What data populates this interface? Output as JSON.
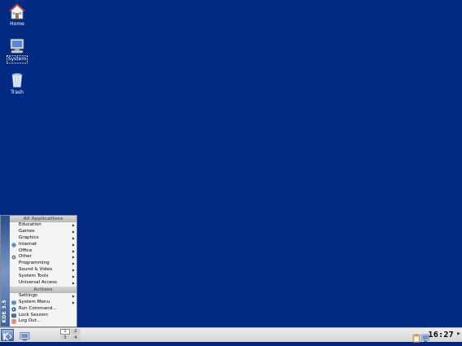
{
  "desktop": {
    "icons": [
      {
        "label": "Home",
        "icon": "home-folder-icon"
      },
      {
        "label": "System",
        "icon": "computer-icon",
        "selected": true
      },
      {
        "label": "Trash",
        "icon": "trash-icon"
      }
    ],
    "background_color": "#032a82"
  },
  "kmenu": {
    "side_label": "KDE 3.5",
    "all_applications_header": "All Applications",
    "applications": [
      {
        "label": "Education",
        "submenu": true
      },
      {
        "label": "Games",
        "submenu": true
      },
      {
        "label": "Graphics",
        "submenu": true
      },
      {
        "label": "Internet",
        "submenu": true,
        "icon": "globe-icon"
      },
      {
        "label": "Office",
        "submenu": true
      },
      {
        "label": "Other",
        "submenu": true,
        "icon": "other-icon"
      },
      {
        "label": "Programming",
        "submenu": true
      },
      {
        "label": "Sound & Video",
        "submenu": true
      },
      {
        "label": "System Tools",
        "submenu": true
      },
      {
        "label": "Universal Access",
        "submenu": true
      }
    ],
    "actions_header": "Actions",
    "actions": [
      {
        "label": "Settings",
        "submenu": true
      },
      {
        "label": "System Menu",
        "submenu": true,
        "icon": "system-menu-icon"
      },
      {
        "label": "Run Command...",
        "icon": "run-command-icon"
      },
      {
        "label": "Lock Session",
        "icon": "lock-icon"
      },
      {
        "label": "Log Out...",
        "icon": "logout-icon"
      }
    ]
  },
  "taskbar": {
    "pager": [
      "1",
      "2",
      "3",
      "4"
    ],
    "active_desktop": "1",
    "clock": "16:27"
  }
}
